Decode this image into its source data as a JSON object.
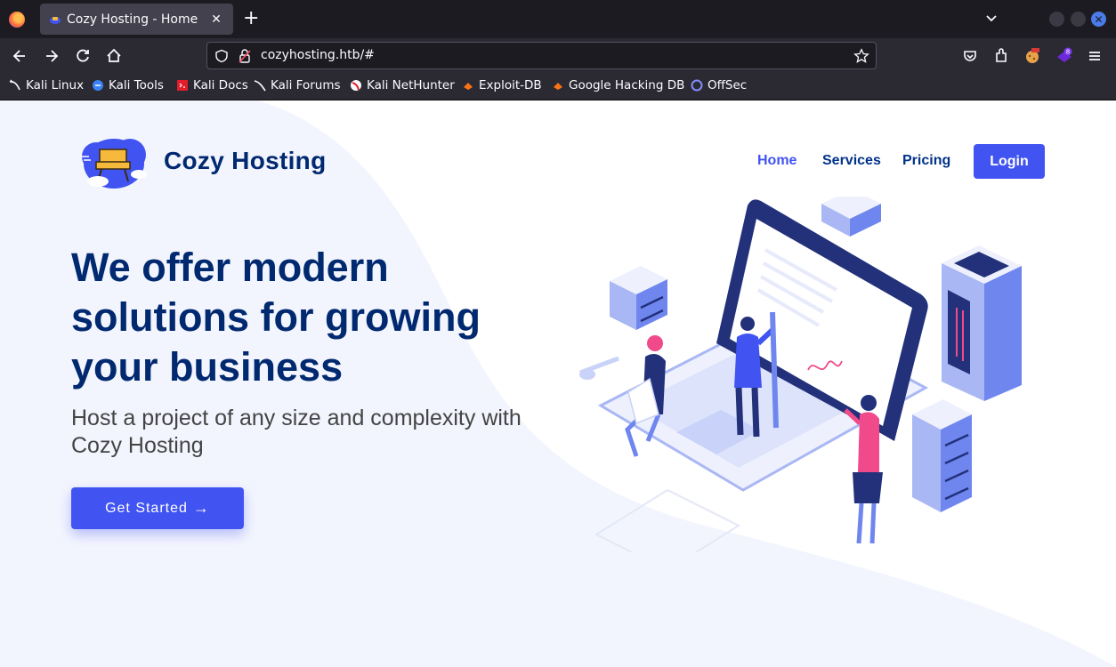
{
  "browser": {
    "tab_title": "Cozy Hosting - Home",
    "tab_close": "✕",
    "new_tab": "+",
    "url": "cozyhosting.htb/#",
    "bookmarks": [
      {
        "label": "Kali Linux",
        "icon": "kali-dragon-icon",
        "color": "#ffffff"
      },
      {
        "label": "Kali Tools",
        "icon": "kali-tools-icon",
        "color": "#3b82f6"
      },
      {
        "label": "Kali Docs",
        "icon": "kali-docs-icon",
        "color": "#e11d2b"
      },
      {
        "label": "Kali Forums",
        "icon": "kali-forums-icon",
        "color": "#ffffff"
      },
      {
        "label": "Kali NetHunter",
        "icon": "nethunter-icon",
        "color": "#e11d2b"
      },
      {
        "label": "Exploit-DB",
        "icon": "exploit-db-icon",
        "color": "#f97316"
      },
      {
        "label": "Google Hacking DB",
        "icon": "ghdb-icon",
        "color": "#f97316"
      },
      {
        "label": "OffSec",
        "icon": "offsec-icon",
        "color": "#6366f1"
      }
    ],
    "extension_badge": "8"
  },
  "site": {
    "brand": "Cozy Hosting",
    "nav": {
      "home": "Home",
      "services": "Services",
      "pricing": "Pricing",
      "login": "Login"
    },
    "hero": {
      "title": "We offer modern solutions for growing your business",
      "subtitle": "Host a project of any size and complexity with Cozy Hosting",
      "cta": "Get Started",
      "cta_arrow": "→"
    }
  },
  "colors": {
    "primary": "#4154f1",
    "heading": "#012970",
    "nav_link": "#013289",
    "chrome_dark": "#1c1b22",
    "chrome_mid": "#2b2a33"
  }
}
